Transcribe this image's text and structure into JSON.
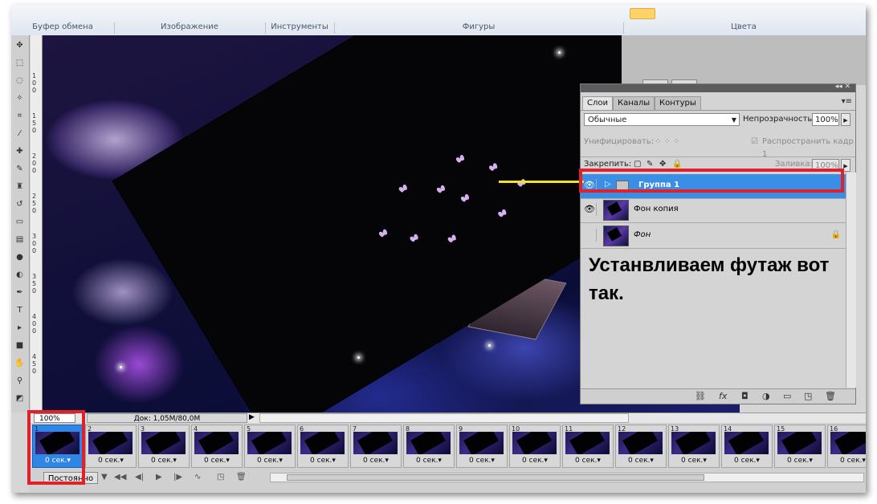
{
  "ribbon": {
    "groups": [
      "Буфер обмена",
      "Изображение",
      "Инструменты",
      "Фигуры",
      "Цвета"
    ]
  },
  "ruler": {
    "ticks": [
      "1",
      "0",
      "0",
      "1",
      "5",
      "0",
      "2",
      "0",
      "0",
      "2",
      "5",
      "0",
      "3",
      "0",
      "0",
      "3",
      "5",
      "0",
      "4",
      "0",
      "0",
      "4",
      "5",
      "0"
    ]
  },
  "layers_panel": {
    "tabs": [
      "Слои",
      "Каналы",
      "Контуры"
    ],
    "blend_mode": "Обычные",
    "opacity_label": "Непрозрачность:",
    "opacity_value": "100%",
    "unify_label": "Унифицировать:",
    "propagate_label": "Распространить кадр 1",
    "lock_label": "Закрепить:",
    "fill_label": "Заливка:",
    "fill_value": "100%",
    "layers": [
      {
        "name": "Группа 1",
        "type": "group",
        "visible": true,
        "selected": true
      },
      {
        "name": "Фон копия",
        "type": "layer",
        "visible": true,
        "selected": false
      },
      {
        "name": "Фон",
        "type": "background",
        "visible": false,
        "selected": false,
        "locked": true
      }
    ],
    "footer_icons": [
      "link-icon",
      "fx-icon",
      "mask-icon",
      "adjustment-icon",
      "folder-icon",
      "new-layer-icon",
      "trash-icon"
    ]
  },
  "annotation": {
    "text": "Устанвливаем футаж вот так.",
    "highlight_color": "#e0202a",
    "pointer_color": "#f3e51a"
  },
  "status": {
    "zoom": "100%",
    "doc": "Док: 1,05M/80,0M"
  },
  "animation": {
    "frames": [
      {
        "num": "1",
        "time": "0 сек."
      },
      {
        "num": "2",
        "time": "0 сек."
      },
      {
        "num": "3",
        "time": "0 сек."
      },
      {
        "num": "4",
        "time": "0 сек."
      },
      {
        "num": "5",
        "time": "0 сек."
      },
      {
        "num": "6",
        "time": "0 сек."
      },
      {
        "num": "7",
        "time": "0 сек."
      },
      {
        "num": "8",
        "time": "0 сек."
      },
      {
        "num": "9",
        "time": "0 сек."
      },
      {
        "num": "10",
        "time": "0 сек."
      },
      {
        "num": "11",
        "time": "0 сек."
      },
      {
        "num": "12",
        "time": "0 сек."
      },
      {
        "num": "13",
        "time": "0 сек."
      },
      {
        "num": "14",
        "time": "0 сек."
      },
      {
        "num": "15",
        "time": "0 сек."
      },
      {
        "num": "16",
        "time": "0 сек."
      }
    ],
    "loop": "Постоянно"
  }
}
